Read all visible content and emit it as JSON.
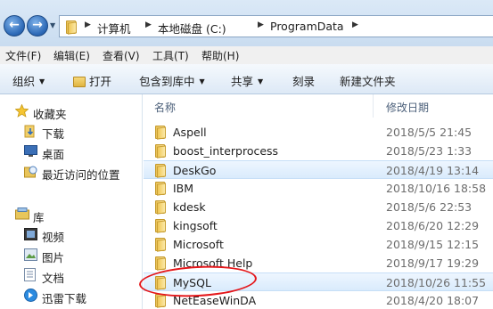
{
  "address": {
    "crumbs": [
      "计算机",
      "本地磁盘 (C:)",
      "ProgramData"
    ]
  },
  "menu": [
    "文件(F)",
    "编辑(E)",
    "查看(V)",
    "工具(T)",
    "帮助(H)"
  ],
  "toolbar": {
    "organize": "组织",
    "open": "打开",
    "include": "包含到库中",
    "share": "共享",
    "burn": "刻录",
    "new_folder": "新建文件夹"
  },
  "nav": {
    "favorites": "收藏夹",
    "downloads": "下载",
    "desktop": "桌面",
    "recent": "最近访问的位置",
    "libraries": "库",
    "videos": "视频",
    "pictures": "图片",
    "documents": "文档",
    "xunlei": "迅雷下载"
  },
  "columns": {
    "name": "名称",
    "modified": "修改日期"
  },
  "files": [
    {
      "name": "Aspell",
      "date": "2018/5/5 21:45"
    },
    {
      "name": "boost_interprocess",
      "date": "2018/5/23 1:33"
    },
    {
      "name": "DeskGo",
      "date": "2018/4/19 13:14"
    },
    {
      "name": "IBM",
      "date": "2018/10/16 18:58"
    },
    {
      "name": "kdesk",
      "date": "2018/5/6 22:53"
    },
    {
      "name": "kingsoft",
      "date": "2018/6/20 12:29"
    },
    {
      "name": "Microsoft",
      "date": "2018/9/15 12:15"
    },
    {
      "name": "Microsoft Help",
      "date": "2018/9/17 19:29"
    },
    {
      "name": "MySQL",
      "date": "2018/10/26 11:55"
    },
    {
      "name": "NetEaseWinDA",
      "date": "2018/4/20 18:07"
    }
  ],
  "colors": {
    "selection": "#d9ebfc",
    "annotation": "#e4161a"
  }
}
